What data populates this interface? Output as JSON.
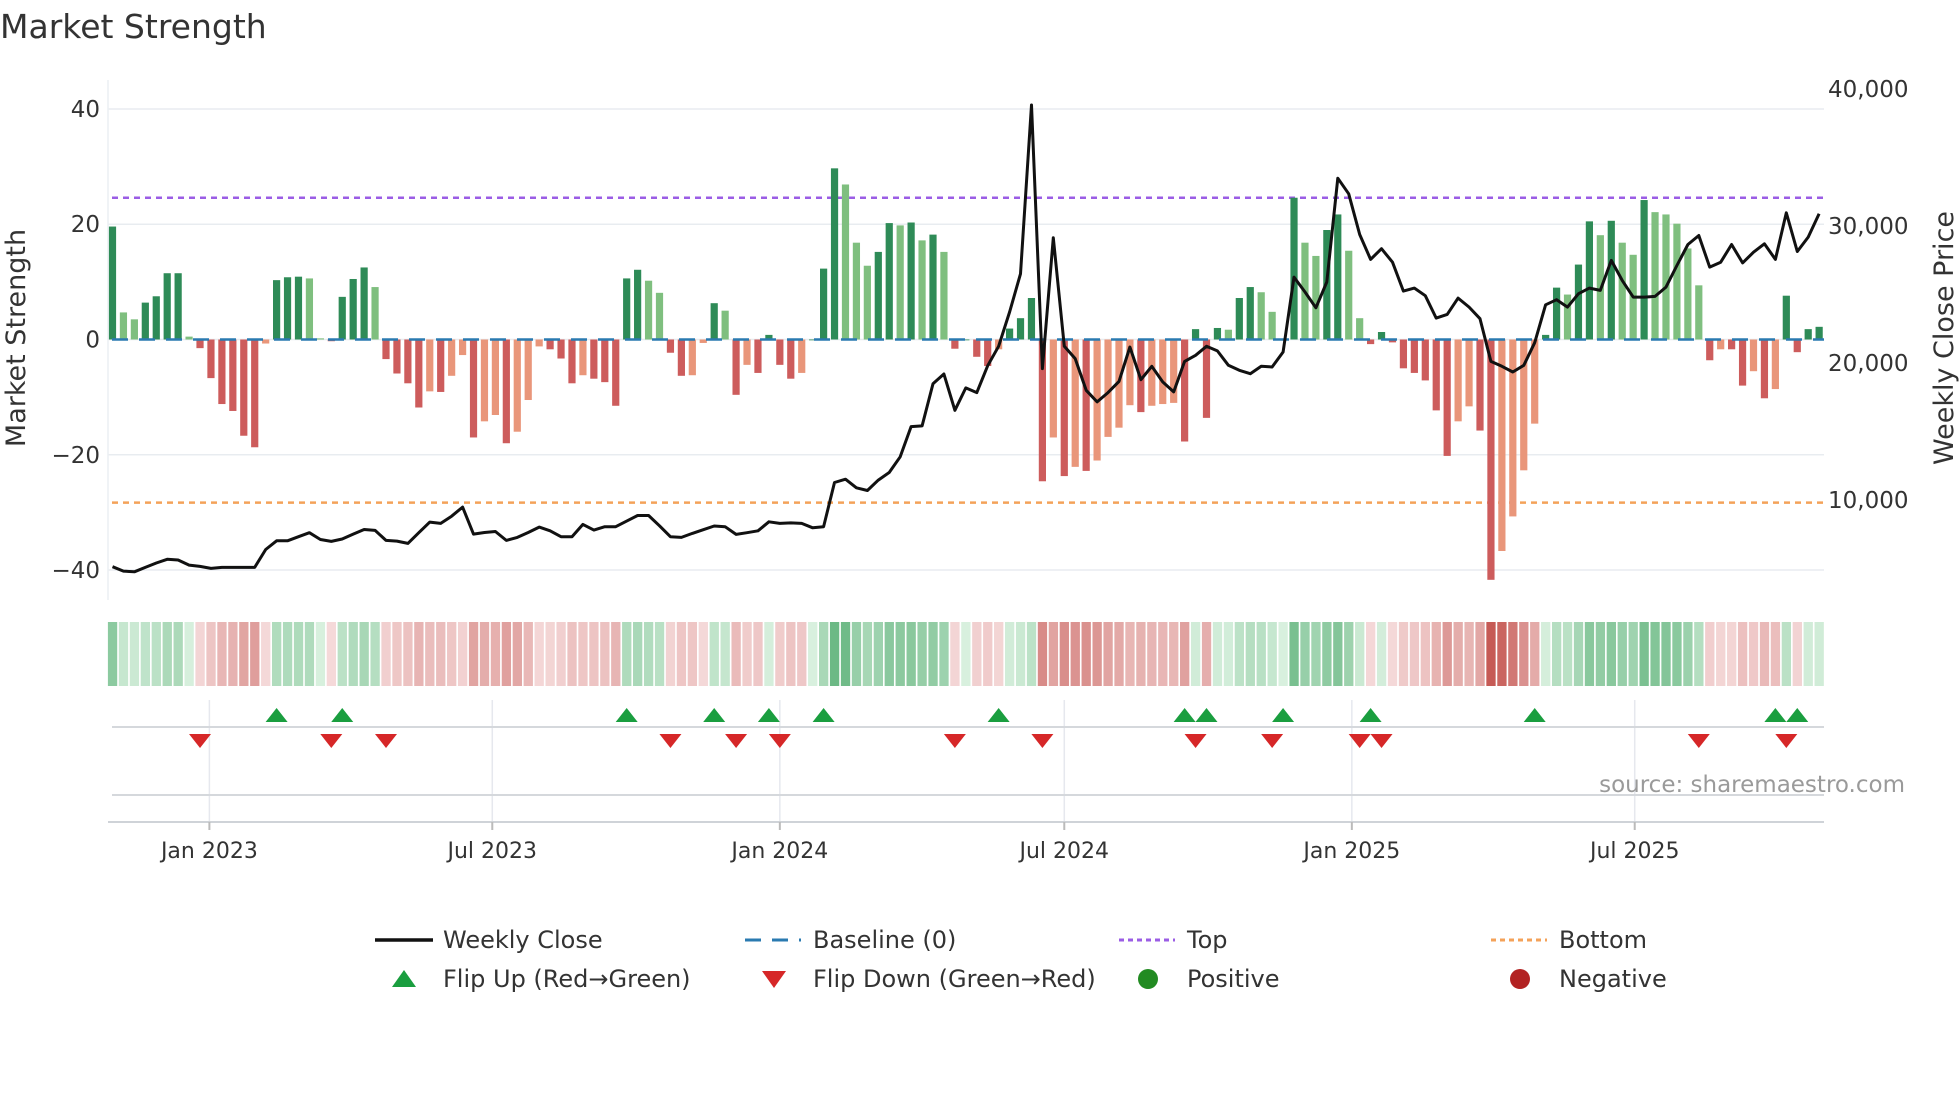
{
  "title": "Market Strength",
  "source": "source: sharemaestro.com",
  "colors": {
    "pos_rising": "#2e8b57",
    "pos_falling": "#7fbf7f",
    "neg_falling": "#cd5c5c",
    "neg_rising": "#e9967a",
    "line": "#111111",
    "baseline": "#2a7ab0",
    "top": "#9b5de5",
    "bottom": "#f4a259",
    "flip_up": "#1a9e3f",
    "flip_down": "#d62728",
    "positive": "#228b22",
    "negative": "#b22222"
  },
  "legend": [
    {
      "label": "Weekly Close",
      "icon": "solid-line"
    },
    {
      "label": "Baseline (0)",
      "icon": "dashed-line"
    },
    {
      "label": "Top",
      "icon": "dotted-line-purple"
    },
    {
      "label": "Bottom",
      "icon": "dotted-line-orange"
    },
    {
      "label": "Flip Up (Red→Green)",
      "icon": "triangle-up"
    },
    {
      "label": "Flip Down (Green→Red)",
      "icon": "triangle-down"
    },
    {
      "label": "Positive",
      "icon": "circle-green"
    },
    {
      "label": "Negative",
      "icon": "circle-red"
    }
  ],
  "chart_data": {
    "type": "bar",
    "ylabel": "Market Strength",
    "y2label": "Weekly Close Price",
    "ylim": [
      -45,
      45
    ],
    "y2lim": [
      3500,
      41000
    ],
    "yticks": [
      "40",
      "20",
      "0",
      "−20",
      "−40"
    ],
    "yticks_values": [
      40,
      20,
      0,
      -20,
      -40
    ],
    "y2ticks": [
      "40,000",
      "30,000",
      "20,000",
      "10,000"
    ],
    "y2ticks_values": [
      40000,
      30000,
      20000,
      10000
    ],
    "xticks": [
      "Jan 2023",
      "Jul 2023",
      "Jan 2024",
      "Jul 2024",
      "Jan 2025",
      "Jul 2025"
    ],
    "xticks_dates": [
      "2023-01-01",
      "2023-07-01",
      "2024-01-01",
      "2024-07-01",
      "2025-01-01",
      "2025-07-01"
    ],
    "top_level": 24.6,
    "bottom_level": -28.3,
    "baseline": 0,
    "grid": true,
    "legend_position": "bottom",
    "dates": [
      "2022-10-31",
      "2022-11-07",
      "2022-11-14",
      "2022-11-21",
      "2022-11-28",
      "2022-12-05",
      "2022-12-12",
      "2022-12-19",
      "2022-12-26",
      "2023-01-02",
      "2023-01-09",
      "2023-01-16",
      "2023-01-23",
      "2023-01-30",
      "2023-02-06",
      "2023-02-13",
      "2023-02-20",
      "2023-02-27",
      "2023-03-06",
      "2023-03-13",
      "2023-03-20",
      "2023-03-27",
      "2023-04-03",
      "2023-04-10",
      "2023-04-17",
      "2023-04-24",
      "2023-05-01",
      "2023-05-08",
      "2023-05-15",
      "2023-05-22",
      "2023-05-29",
      "2023-06-05",
      "2023-06-12",
      "2023-06-19",
      "2023-06-26",
      "2023-07-03",
      "2023-07-10",
      "2023-07-17",
      "2023-07-24",
      "2023-07-31",
      "2023-08-07",
      "2023-08-14",
      "2023-08-21",
      "2023-08-28",
      "2023-09-04",
      "2023-09-11",
      "2023-09-18",
      "2023-09-25",
      "2023-10-02",
      "2023-10-09",
      "2023-10-16",
      "2023-10-23",
      "2023-10-30",
      "2023-11-06",
      "2023-11-13",
      "2023-11-20",
      "2023-11-27",
      "2023-12-04",
      "2023-12-11",
      "2023-12-18",
      "2023-12-25",
      "2024-01-01",
      "2024-01-08",
      "2024-01-15",
      "2024-01-22",
      "2024-01-29",
      "2024-02-05",
      "2024-02-12",
      "2024-02-19",
      "2024-02-26",
      "2024-03-04",
      "2024-03-11",
      "2024-03-18",
      "2024-03-25",
      "2024-04-01",
      "2024-04-08",
      "2024-04-15",
      "2024-04-22",
      "2024-04-29",
      "2024-05-06",
      "2024-05-13",
      "2024-05-20",
      "2024-05-27",
      "2024-06-03",
      "2024-06-10",
      "2024-06-17",
      "2024-06-24",
      "2024-07-01",
      "2024-07-08",
      "2024-07-15",
      "2024-07-22",
      "2024-07-29",
      "2024-08-05",
      "2024-08-12",
      "2024-08-19",
      "2024-08-26",
      "2024-09-02",
      "2024-09-09",
      "2024-09-16",
      "2024-09-23",
      "2024-09-30",
      "2024-10-07",
      "2024-10-14",
      "2024-10-21",
      "2024-10-28",
      "2024-11-04",
      "2024-11-11",
      "2024-11-18",
      "2024-11-25",
      "2024-12-02",
      "2024-12-09",
      "2024-12-16",
      "2024-12-23",
      "2024-12-30",
      "2025-01-06",
      "2025-01-13",
      "2025-01-20",
      "2025-01-27",
      "2025-02-03",
      "2025-02-10",
      "2025-02-17",
      "2025-02-24",
      "2025-03-03",
      "2025-03-10",
      "2025-03-17",
      "2025-03-24",
      "2025-03-31",
      "2025-04-07",
      "2025-04-14",
      "2025-04-21",
      "2025-04-28",
      "2025-05-05",
      "2025-05-12",
      "2025-05-19",
      "2025-05-26",
      "2025-06-02",
      "2025-06-09",
      "2025-06-16",
      "2025-06-23",
      "2025-06-30",
      "2025-07-07",
      "2025-07-14",
      "2025-07-21",
      "2025-07-28",
      "2025-08-04",
      "2025-08-11",
      "2025-08-18",
      "2025-08-25",
      "2025-09-01",
      "2025-09-08",
      "2025-09-15",
      "2025-09-22",
      "2025-09-29",
      "2025-10-06",
      "2025-10-13",
      "2025-10-20",
      "2025-10-27"
    ],
    "strength": [
      19.6,
      4.7,
      3.5,
      6.4,
      7.5,
      11.5,
      11.5,
      0.5,
      -1.5,
      -6.7,
      -11.2,
      -12.4,
      -16.7,
      -18.7,
      -0.7,
      10.3,
      10.8,
      10.9,
      10.6,
      0.2,
      -0.3,
      7.4,
      10.5,
      12.5,
      9.1,
      -3.4,
      -5.9,
      -7.6,
      -11.8,
      -9.0,
      -9.1,
      -6.3,
      -2.7,
      -17.0,
      -14.2,
      -13.1,
      -18.0,
      -16.0,
      -10.5,
      -1.2,
      -1.7,
      -3.3,
      -7.6,
      -6.2,
      -6.8,
      -7.4,
      -11.5,
      10.6,
      12.1,
      10.2,
      8.1,
      -2.3,
      -6.3,
      -6.2,
      -0.6,
      6.3,
      5.0,
      -9.6,
      -4.4,
      -5.8,
      0.8,
      -4.4,
      -6.8,
      -5.8,
      0.0,
      12.3,
      29.7,
      26.9,
      16.8,
      12.8,
      15.2,
      20.2,
      19.8,
      20.3,
      17.2,
      18.2,
      15.2,
      -1.6,
      0.0,
      -3.0,
      -4.6,
      -1.7,
      1.9,
      3.7,
      7.2,
      -24.6,
      -17.0,
      -23.7,
      -22.1,
      -22.8,
      -21.0,
      -16.9,
      -15.3,
      -11.4,
      -12.6,
      -11.5,
      -11.2,
      -11.0,
      -17.7,
      1.8,
      -13.6,
      2.0,
      1.7,
      7.2,
      9.1,
      8.2,
      4.8,
      0.0,
      24.6,
      16.8,
      14.5,
      19.0,
      21.7,
      15.4,
      3.7,
      -0.8,
      1.3,
      -0.5,
      -5.0,
      -5.8,
      -7.1,
      -12.3,
      -20.2,
      -14.2,
      -11.6,
      -15.8,
      -41.7,
      -36.7,
      -30.7,
      -22.7,
      -14.6,
      0.8,
      9.0,
      7.8,
      13.0,
      20.5,
      18.1,
      20.6,
      16.8,
      14.7,
      24.2,
      22.1,
      21.7,
      20.1,
      15.8,
      9.4,
      -3.6,
      -1.7,
      -1.7,
      -8.0,
      -5.5,
      -10.2,
      -8.6,
      7.6,
      -2.2,
      1.8,
      2.2
    ],
    "weekly_close": [
      5130,
      4810,
      4760,
      5080,
      5400,
      5670,
      5620,
      5250,
      5150,
      5010,
      5080,
      5080,
      5080,
      5080,
      6390,
      7020,
      7020,
      7320,
      7610,
      7120,
      6980,
      7150,
      7510,
      7850,
      7780,
      7050,
      7000,
      6830,
      7610,
      8390,
      8290,
      8820,
      9480,
      7510,
      7630,
      7700,
      7050,
      7270,
      7630,
      8020,
      7750,
      7320,
      7320,
      8220,
      7800,
      8050,
      8050,
      8460,
      8870,
      8870,
      8120,
      7320,
      7270,
      7560,
      7830,
      8100,
      8050,
      7490,
      7610,
      7750,
      8410,
      8290,
      8330,
      8290,
      7970,
      8050,
      11280,
      11520,
      10890,
      10690,
      11450,
      12010,
      13150,
      15360,
      15410,
      18490,
      19200,
      16550,
      18180,
      17840,
      19800,
      21220,
      23720,
      26510,
      38830,
      19590,
      29140,
      21220,
      20320,
      18010,
      17160,
      17840,
      18660,
      21170,
      18780,
      19760,
      18620,
      17890,
      20120,
      20560,
      21220,
      20880,
      19830,
      19470,
      19220,
      19760,
      19710,
      20800,
      26270,
      25180,
      24030,
      25910,
      33490,
      32350,
      29380,
      27560,
      28340,
      27360,
      25250,
      25470,
      24910,
      23280,
      23550,
      24740,
      24080,
      23230,
      20120,
      19760,
      19340,
      19830,
      21480,
      24250,
      24620,
      24080,
      25060,
      25470,
      25300,
      27490,
      26030,
      24810,
      24810,
      24860,
      25540,
      27120,
      28650,
      29310,
      27000,
      27360,
      28650,
      27310,
      28090,
      28700,
      27560,
      30960,
      28140,
      29190,
      30890
    ],
    "flip_up_dates": [
      "2023-02-13",
      "2023-03-27",
      "2023-09-25",
      "2023-11-20",
      "2023-12-25",
      "2024-01-29",
      "2024-05-20",
      "2024-09-16",
      "2024-09-30",
      "2024-11-18",
      "2025-01-13",
      "2025-04-28",
      "2025-09-29",
      "2025-10-13"
    ],
    "flip_down_dates": [
      "2022-12-26",
      "2023-03-20",
      "2023-04-24",
      "2023-10-23",
      "2023-12-04",
      "2024-01-01",
      "2024-04-22",
      "2024-06-17",
      "2024-09-23",
      "2024-11-11",
      "2025-01-06",
      "2025-01-20",
      "2025-08-11",
      "2025-10-06"
    ]
  }
}
